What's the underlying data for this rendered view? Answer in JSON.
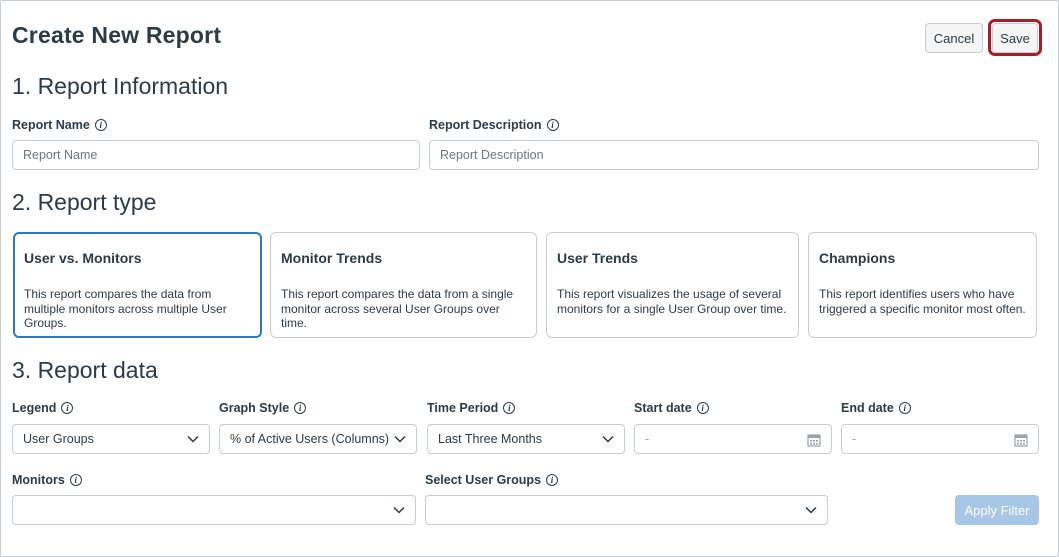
{
  "header": {
    "title": "Create New Report",
    "cancel_label": "Cancel",
    "save_label": "Save"
  },
  "section1": {
    "title": "1. Report Information",
    "report_name": {
      "label": "Report Name",
      "placeholder": "Report Name",
      "value": ""
    },
    "report_description": {
      "label": "Report Description",
      "placeholder": "Report Description",
      "value": ""
    }
  },
  "section2": {
    "title": "2. Report type",
    "cards": [
      {
        "title": "User vs. Monitors",
        "description": "This report compares the data from multiple monitors across multiple User Groups.",
        "selected": true
      },
      {
        "title": "Monitor Trends",
        "description": "This report compares the data from a single monitor across several User Groups over time.",
        "selected": false
      },
      {
        "title": "User Trends",
        "description": "This report visualizes the usage of several monitors for a single User Group over time.",
        "selected": false
      },
      {
        "title": "Champions",
        "description": "This report identifies users who have triggered a specific monitor most often.",
        "selected": false
      }
    ]
  },
  "section3": {
    "title": "3. Report data",
    "legend": {
      "label": "Legend",
      "value": "User Groups"
    },
    "graph_style": {
      "label": "Graph Style",
      "value": "% of Active Users (Columns)"
    },
    "time_period": {
      "label": "Time Period",
      "value": "Last Three Months"
    },
    "start_date": {
      "label": "Start date",
      "value": "-"
    },
    "end_date": {
      "label": "End date",
      "value": "-"
    },
    "monitors": {
      "label": "Monitors",
      "value": ""
    },
    "user_groups": {
      "label": "Select User Groups",
      "value": ""
    },
    "apply_label": "Apply Filter"
  },
  "colors": {
    "selected_border": "#2b7abc",
    "save_highlight": "#a1202a",
    "apply_disabled_bg": "#a8c6e5"
  },
  "icons": [
    "info-icon",
    "chevron-down-icon",
    "calendar-icon"
  ]
}
